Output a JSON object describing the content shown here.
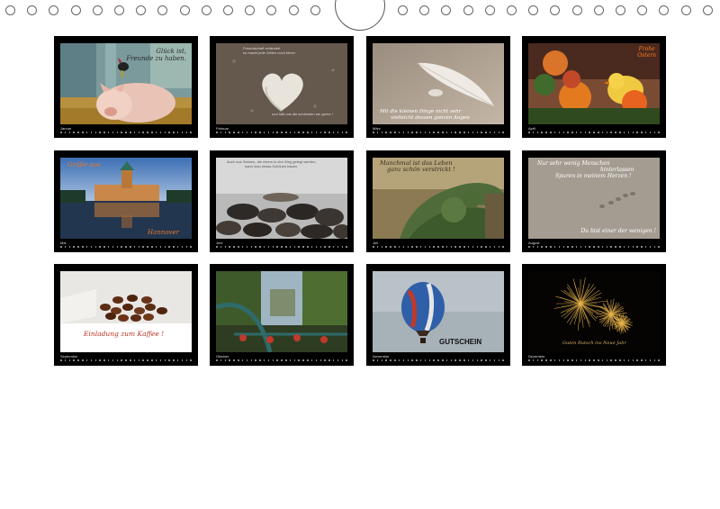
{
  "months": [
    {
      "key": "januar",
      "label": "Januar",
      "caption_lines": [
        "Glück ist,",
        "Freunde zu haben."
      ]
    },
    {
      "key": "februar",
      "label": "Februar",
      "caption_top": [
        "Freundschaft verändert",
        "so macht jede Zeiten noch feiner"
      ],
      "caption_bottom": [
        "und hält uns die schönsten am gerne !"
      ]
    },
    {
      "key": "maerz",
      "label": "März",
      "caption_lines": [
        "Mit die kleinen Dinge nicht sehr",
        "vielleicht dessen ganzen Augen"
      ]
    },
    {
      "key": "april",
      "label": "April",
      "caption_lines": [
        "Frohe",
        "Ostern"
      ]
    },
    {
      "key": "mai",
      "label": "Mai",
      "caption_top": [
        "Grüße aus"
      ],
      "caption_bottom": [
        "Hannover"
      ]
    },
    {
      "key": "juni",
      "label": "Juni",
      "caption_lines": [
        "Auch aus Steinen, die einem in den Weg gelegt werden,",
        "kann man etwas Schönes bauen."
      ]
    },
    {
      "key": "juli",
      "label": "Juli",
      "caption_lines": [
        "Manchmal ist das Leben",
        "ganz schön verstrickt !"
      ]
    },
    {
      "key": "august",
      "label": "August",
      "caption_top": [
        "Nur sehr wenig Menschen",
        "hinterlassen",
        "Spuren in meinem Herzen !"
      ],
      "caption_bottom": [
        "Du bist einer der wenigen !"
      ]
    },
    {
      "key": "september",
      "label": "September",
      "caption_lines": [
        "Einladung zum Kaffee !"
      ]
    },
    {
      "key": "oktober",
      "label": "Oktober",
      "caption_lines": []
    },
    {
      "key": "november",
      "label": "November",
      "caption_lines": [
        "GUTSCHEIN"
      ]
    },
    {
      "key": "dezember",
      "label": "Dezember",
      "caption_lines": [
        "Guten Rutsch ins Neue Jahr"
      ]
    }
  ],
  "colors": {
    "frame": "#000000",
    "page": "#ffffff",
    "ring": "#666666"
  }
}
